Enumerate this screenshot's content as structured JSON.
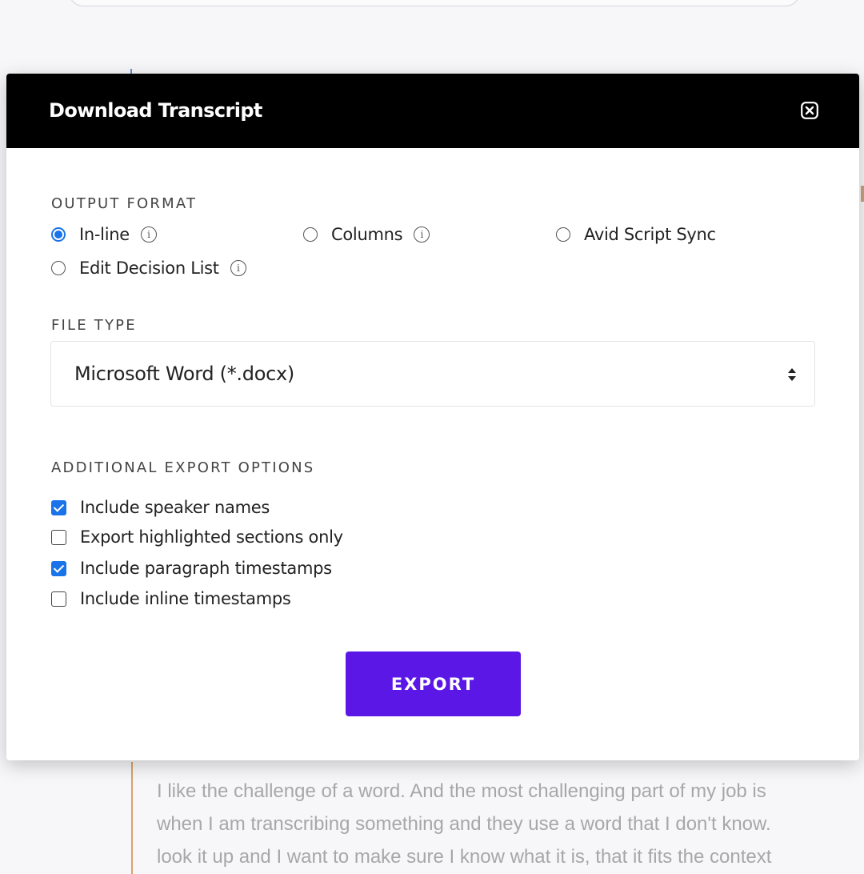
{
  "modal": {
    "title": "Download Transcript"
  },
  "output_format": {
    "label": "OUTPUT FORMAT",
    "options": [
      {
        "label": "In-line",
        "selected": true,
        "has_info": true
      },
      {
        "label": "Columns",
        "selected": false,
        "has_info": true
      },
      {
        "label": "Avid Script Sync",
        "selected": false,
        "has_info": false
      },
      {
        "label": "Edit Decision List",
        "selected": false,
        "has_info": true
      }
    ]
  },
  "file_type": {
    "label": "FILE TYPE",
    "selected": "Microsoft Word (*.docx)"
  },
  "additional_options": {
    "label": "ADDITIONAL EXPORT OPTIONS",
    "items": [
      {
        "label": "Include speaker names",
        "checked": true
      },
      {
        "label": "Export highlighted sections only",
        "checked": false
      },
      {
        "label": "Include paragraph timestamps",
        "checked": true
      },
      {
        "label": "Include inline timestamps",
        "checked": false
      }
    ]
  },
  "export_label": "EXPORT",
  "background": {
    "transcript_lines": [
      "I like the challenge of a word. And the most challenging part of my job is",
      "when I am transcribing something and they use a word that I don't know.",
      "look it up and I want to make sure I know what it is, that it fits the context"
    ]
  },
  "colors": {
    "header_bg": "#000000",
    "accent": "#1a73e8",
    "export_button": "#5a17e6"
  },
  "icons": {
    "close": "close-icon",
    "info": "info-icon",
    "select_arrows": "sort-arrows-icon"
  }
}
